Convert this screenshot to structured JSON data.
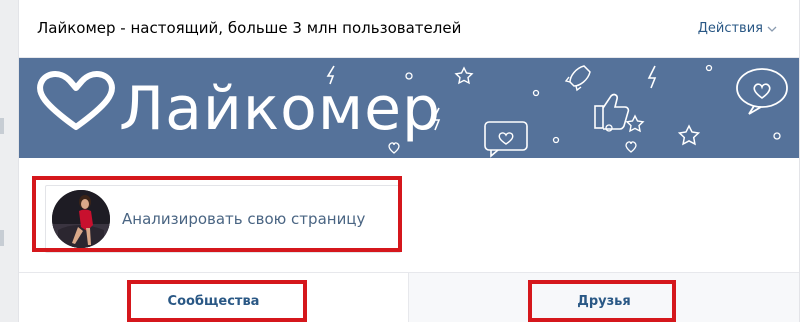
{
  "header": {
    "title": "Лайкомер - настоящий, больше 3 млн пользователей",
    "actions_label": "Действия"
  },
  "banner": {
    "name": "Лайкомер",
    "background_color": "#55729a",
    "icons": [
      "heart-icon",
      "lightning-icon",
      "star-icon",
      "rocket-icon",
      "thumbs-up-icon",
      "speech-bubble-heart-icon"
    ]
  },
  "app": {
    "analyze_label": "Анализировать свою страницу"
  },
  "tabs": {
    "communities_label": "Сообщества",
    "friends_label": "Друзья"
  },
  "colors": {
    "link": "#2a5885",
    "highlight": "#d5171c"
  }
}
